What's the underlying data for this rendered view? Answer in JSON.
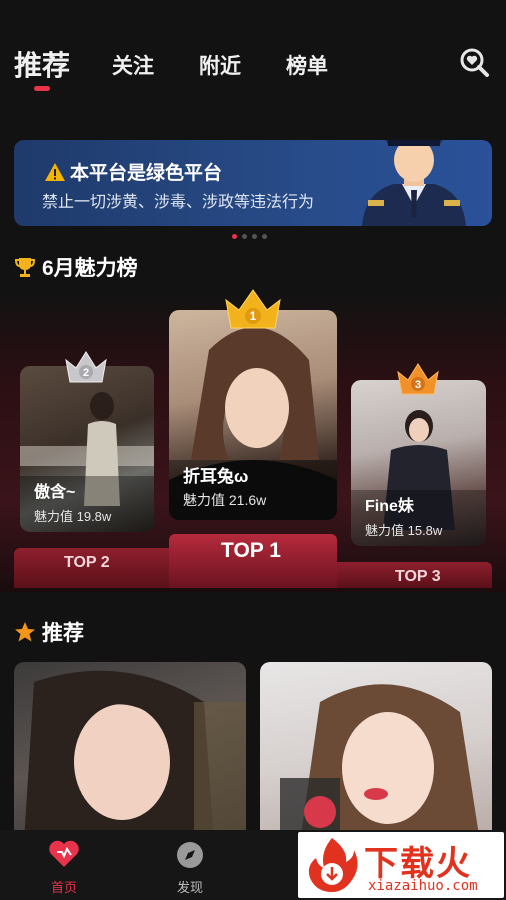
{
  "tabs": [
    {
      "label": "推荐"
    },
    {
      "label": "关注"
    },
    {
      "label": "附近"
    },
    {
      "label": "榜单"
    }
  ],
  "icons": {
    "search": "search-heart-icon",
    "warning": "warning-icon",
    "trophy": "trophy-icon",
    "star": "star-icon",
    "home": "heart-home-icon",
    "discover": "compass-icon"
  },
  "banner": {
    "title": "本平台是绿色平台",
    "subtitle": "禁止一切涉黄、涉毒、涉政等违法行为"
  },
  "ranking": {
    "title": "6月魅力榜",
    "top1": {
      "rank": "1",
      "name": "折耳兔ω",
      "charm": "魅力值 21.6w",
      "label": "TOP 1"
    },
    "top2": {
      "rank": "2",
      "name": "傲含~",
      "charm": "魅力值 19.8w",
      "label": "TOP 2"
    },
    "top3": {
      "rank": "3",
      "name": "Fine妹",
      "charm": "魅力值 15.8w",
      "label": "TOP 3"
    }
  },
  "recommend": {
    "title": "推荐"
  },
  "bottom_nav": {
    "items": [
      {
        "label": "首页"
      },
      {
        "label": "发现"
      }
    ]
  },
  "watermark": {
    "brand": "下载火",
    "url": "xiazaihuo.com"
  },
  "colors": {
    "accent": "#e8334a",
    "gold": "#f2b21b",
    "banner_blue": "#274a86"
  }
}
